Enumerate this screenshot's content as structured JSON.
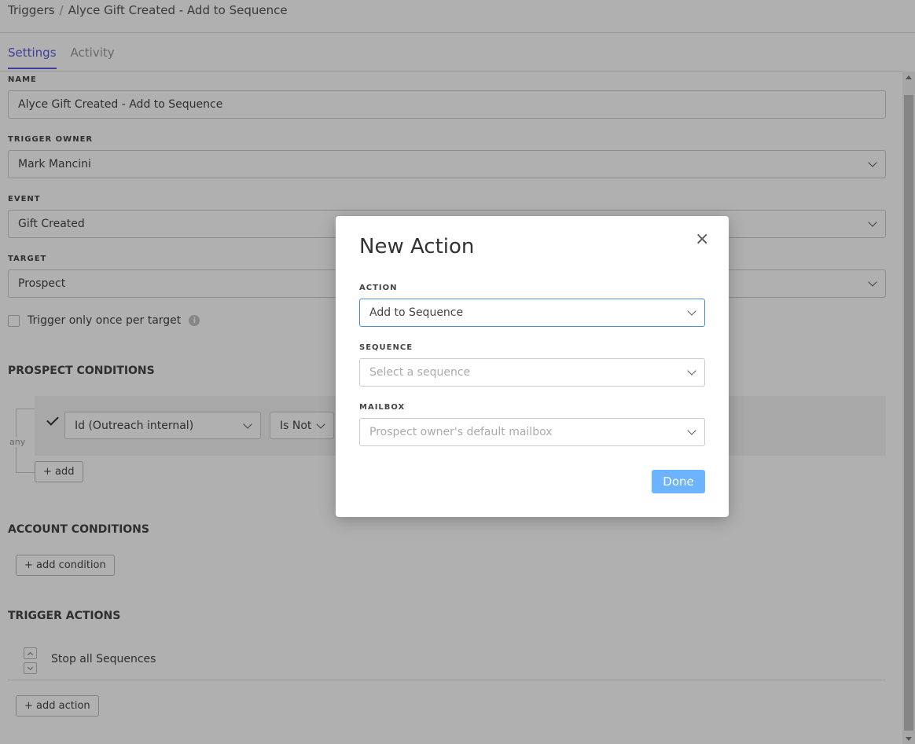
{
  "breadcrumb": {
    "root": "Triggers",
    "separator": "/",
    "current": "Alyce Gift Created - Add to Sequence"
  },
  "tabs": [
    {
      "label": "Settings",
      "active": true
    },
    {
      "label": "Activity",
      "active": false
    }
  ],
  "form": {
    "name_label": "NAME",
    "name_value": "Alyce Gift Created - Add to Sequence",
    "owner_label": "TRIGGER OWNER",
    "owner_value": "Mark Mancini",
    "event_label": "EVENT",
    "event_value": "Gift Created",
    "target_label": "TARGET",
    "target_value": "Prospect",
    "once_label": "Trigger only once per target",
    "info_glyph": "i"
  },
  "prospect_conditions": {
    "title": "PROSPECT CONDITIONS",
    "any_label": "any",
    "field_value": "Id (Outreach internal)",
    "operator_value": "Is Not",
    "add_label": "+ add"
  },
  "account_conditions": {
    "title": "ACCOUNT CONDITIONS",
    "add_label": "+ add condition"
  },
  "trigger_actions": {
    "title": "TRIGGER ACTIONS",
    "item_label": "Stop all Sequences",
    "add_label": "+ add action"
  },
  "modal": {
    "title": "New Action",
    "close_glyph": "×",
    "action_label": "ACTION",
    "action_value": "Add to Sequence",
    "sequence_label": "SEQUENCE",
    "sequence_placeholder": "Select a sequence",
    "mailbox_label": "MAILBOX",
    "mailbox_placeholder": "Prospect owner's default mailbox",
    "done_label": "Done"
  },
  "colors": {
    "accent": "#5c5ce0",
    "done_button": "#6cb4ff",
    "focus_border": "#4a90d9"
  },
  "icons": {
    "chevron": "chevron-down-icon",
    "check": "check-icon",
    "info": "info-icon",
    "close": "close-icon"
  }
}
